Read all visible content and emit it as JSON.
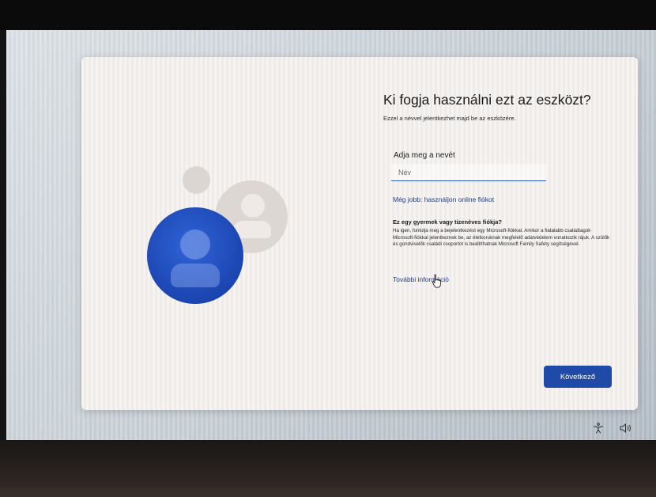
{
  "setup": {
    "title": "Ki fogja használni ezt az eszközt?",
    "subtitle": "Ezzel a névvel jelentkezhet majd be az eszközére.",
    "name_field": {
      "label": "Adja meg a nevét",
      "placeholder": "Név",
      "value": ""
    },
    "online_account_link": "Még jobb: használjon online fiókot",
    "child_heading": "Ez egy gyermek vagy tizenéves fiókja?",
    "child_text": "Ha igen, fontolja meg a bejelentkezést egy Microsoft-fiókkal. Amikor a fiatalabb családtagok Microsoft-fiókkal jelentkeznek be, az életkoruknak megfelelő adatvédelem vonatkozik rájuk. A szülők és gondviselők családi csoportot is beállíthatnak Microsoft Family Safety segítségével.",
    "more_info_link": "További információ",
    "next_button": "Következő"
  },
  "taskbar": {
    "icons": [
      "accessibility-icon",
      "volume-icon"
    ]
  },
  "colors": {
    "accent": "#1f4aa8",
    "link": "#1d3f86",
    "card_background": "#f1eeec"
  }
}
